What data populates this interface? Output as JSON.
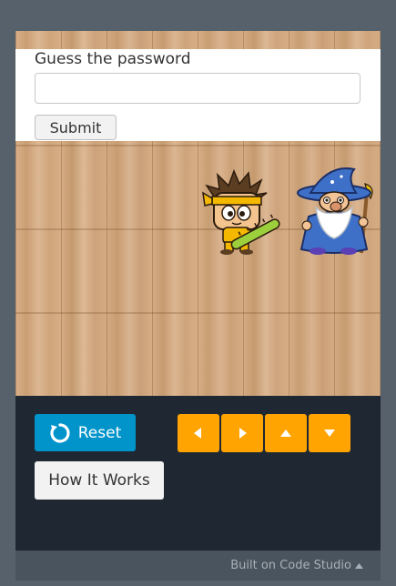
{
  "password_form": {
    "label": "Guess the password",
    "input_value": "",
    "submit_label": "Submit"
  },
  "stage": {
    "characters": [
      "ninja",
      "wizard"
    ]
  },
  "controls": {
    "reset_label": "Reset",
    "how_it_works_label": "How It Works",
    "arrows": [
      "left",
      "right",
      "up",
      "down"
    ]
  },
  "footer": {
    "link_text": "Built on Code Studio"
  },
  "colors": {
    "reset_blue": "#0094ca",
    "arrow_orange": "#ffa400",
    "panel_dark": "#1f2832"
  }
}
